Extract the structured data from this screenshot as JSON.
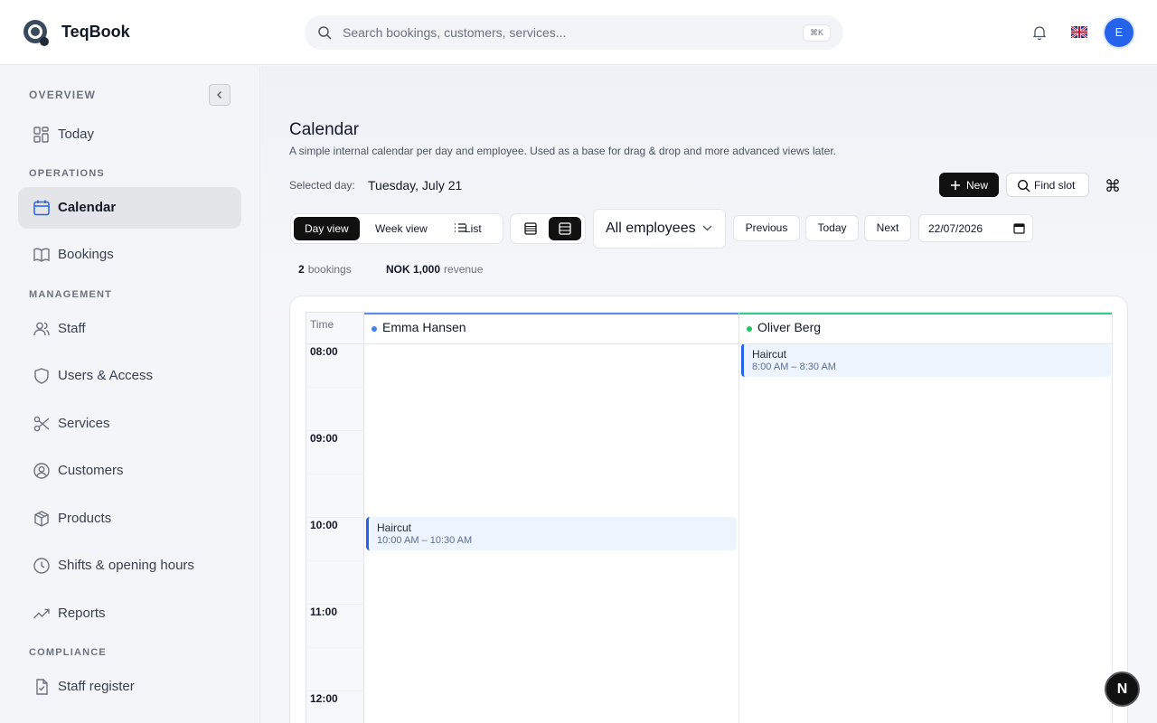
{
  "app": {
    "name": "TeqBook"
  },
  "search": {
    "placeholder": "Search bookings, customers, services...",
    "shortcut": "⌘K"
  },
  "header": {
    "avatar_initial": "E",
    "language_icon": "uk-flag-icon",
    "notification_icon": "bell-icon"
  },
  "sidebar": {
    "sections": {
      "overview": "OVERVIEW",
      "operations": "OPERATIONS",
      "management": "MANAGEMENT",
      "compliance": "COMPLIANCE"
    },
    "items": [
      {
        "label": "Today",
        "icon": "grid-icon"
      },
      {
        "label": "Calendar",
        "icon": "calendar-icon",
        "active": true
      },
      {
        "label": "Bookings",
        "icon": "book-icon"
      },
      {
        "label": "Staff",
        "icon": "users-icon"
      },
      {
        "label": "Users & Access",
        "icon": "shield-icon"
      },
      {
        "label": "Services",
        "icon": "scissors-icon"
      },
      {
        "label": "Customers",
        "icon": "user-circle-icon"
      },
      {
        "label": "Products",
        "icon": "box-icon"
      },
      {
        "label": "Shifts & opening hours",
        "icon": "clock-icon"
      },
      {
        "label": "Reports",
        "icon": "trend-icon"
      },
      {
        "label": "Staff register",
        "icon": "clipboard-check-icon"
      }
    ]
  },
  "page": {
    "title": "Calendar",
    "subtitle": "A simple internal calendar per day and employee. Used as a base for drag & drop and more advanced views later.",
    "selected_day_label": "Selected day:",
    "selected_day_value": "Tuesday, July 21",
    "new_label": "New",
    "find_slot_label": "Find slot",
    "shortcut_glyph": "⌘"
  },
  "toolbar": {
    "views": [
      "Day view",
      "Week view",
      "List"
    ],
    "active_view": "Day view",
    "employee_filter": "All employees",
    "previous": "Previous",
    "today": "Today",
    "next": "Next",
    "date": "22/07/2026"
  },
  "stats": {
    "bookings_count": "2",
    "bookings_label": "bookings",
    "revenue_value": "NOK 1,000",
    "revenue_label": "revenue"
  },
  "calendar": {
    "time_header": "Time",
    "hours": [
      "08:00",
      "09:00",
      "10:00",
      "11:00",
      "12:00"
    ],
    "employees": [
      {
        "name": "Emma Hansen",
        "color": "#3b82f6"
      },
      {
        "name": "Oliver Berg",
        "color": "#22c55e"
      }
    ],
    "events": [
      {
        "employee": "Oliver Berg",
        "title": "Haircut",
        "time": "8:00 AM – 8:30 AM"
      },
      {
        "employee": "Emma Hansen",
        "title": "Haircut",
        "time": "10:00 AM – 10:30 AM"
      }
    ]
  },
  "fab": {
    "label": "N"
  },
  "colors": {
    "accent": "#2563eb",
    "dark": "#111111"
  }
}
